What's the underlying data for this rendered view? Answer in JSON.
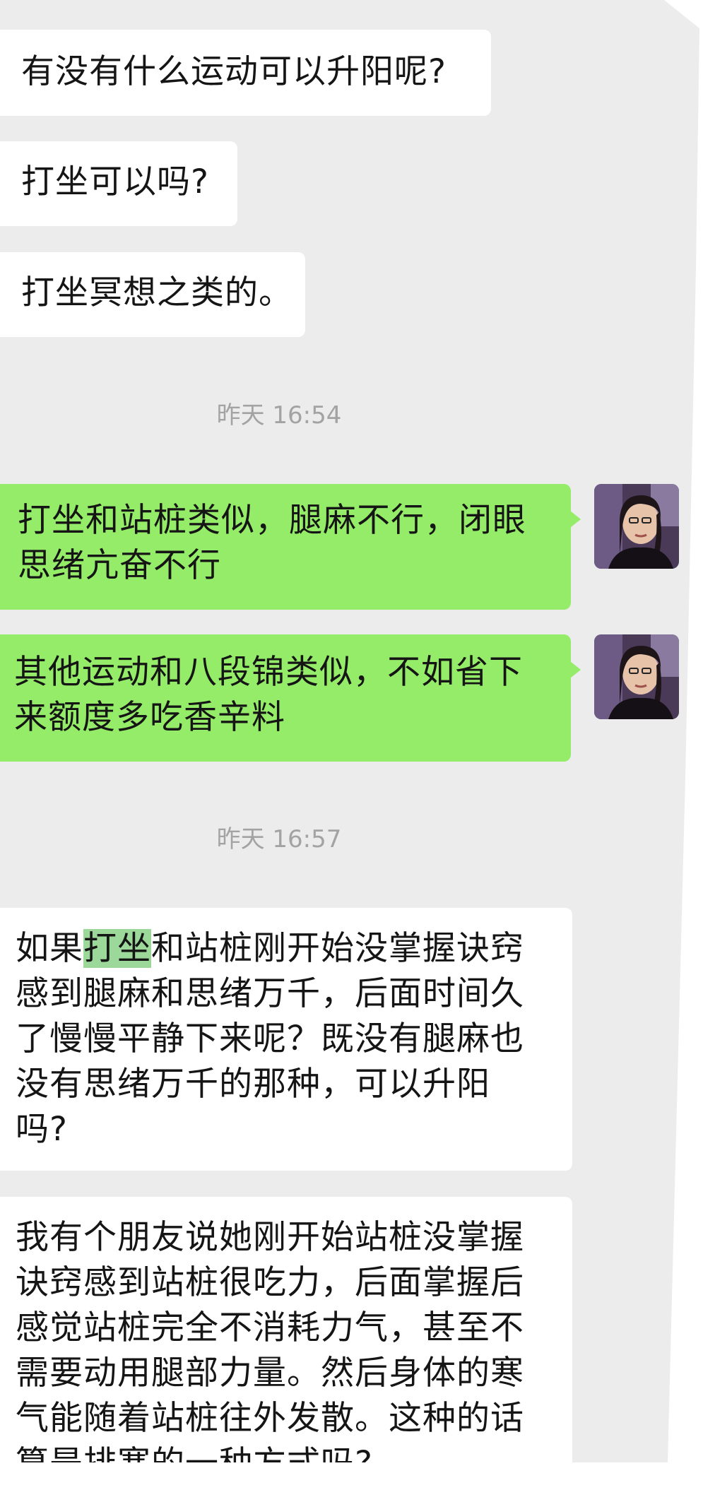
{
  "chat": {
    "messages": [
      {
        "id": "m1",
        "side": "in",
        "text": "有没有什么运动可以升阳呢?"
      },
      {
        "id": "m2",
        "side": "in",
        "text": "打坐可以吗?"
      },
      {
        "id": "m3",
        "side": "in",
        "text": "打坐冥想之类的。"
      },
      {
        "id": "m4",
        "side": "out",
        "text": "打坐和站桩类似，腿麻不行，闭眼\n思绪亢奋不行"
      },
      {
        "id": "m5",
        "side": "out",
        "text": "其他运动和八段锦类似，不如省下\n来额度多吃香辛料"
      },
      {
        "id": "m6",
        "side": "in",
        "text_before": "如果",
        "text_highlight": "打坐",
        "text_after": "和站桩刚开始没掌握诀窍\n感到腿麻和思绪万千，后面时间久\n了慢慢平静下来呢？既没有腿麻也\n没有思绪万千的那种，可以升阳\n吗?"
      },
      {
        "id": "m7",
        "side": "in",
        "text": "我有个朋友说她刚开始站桩没掌握\n诀窍感到站桩很吃力，后面掌握后\n感觉站桩完全不消耗力气，甚至不\n需要动用腿部力量。然后身体的寒\n气能随着站桩往外发散。这种的话\n算是排寒的一种方式吗?"
      }
    ],
    "timestamps": [
      {
        "id": "t1",
        "text": "昨天 16:54"
      },
      {
        "id": "t2",
        "text": "昨天 16:57"
      }
    ]
  },
  "colors": {
    "outgoing_bubble": "#95ec69",
    "incoming_bubble": "#ffffff",
    "chat_background": "#ececec",
    "timestamp_text": "#a3a3a3",
    "highlight": "#9bd89a"
  },
  "icons": {
    "avatar": "user-avatar-photo"
  }
}
